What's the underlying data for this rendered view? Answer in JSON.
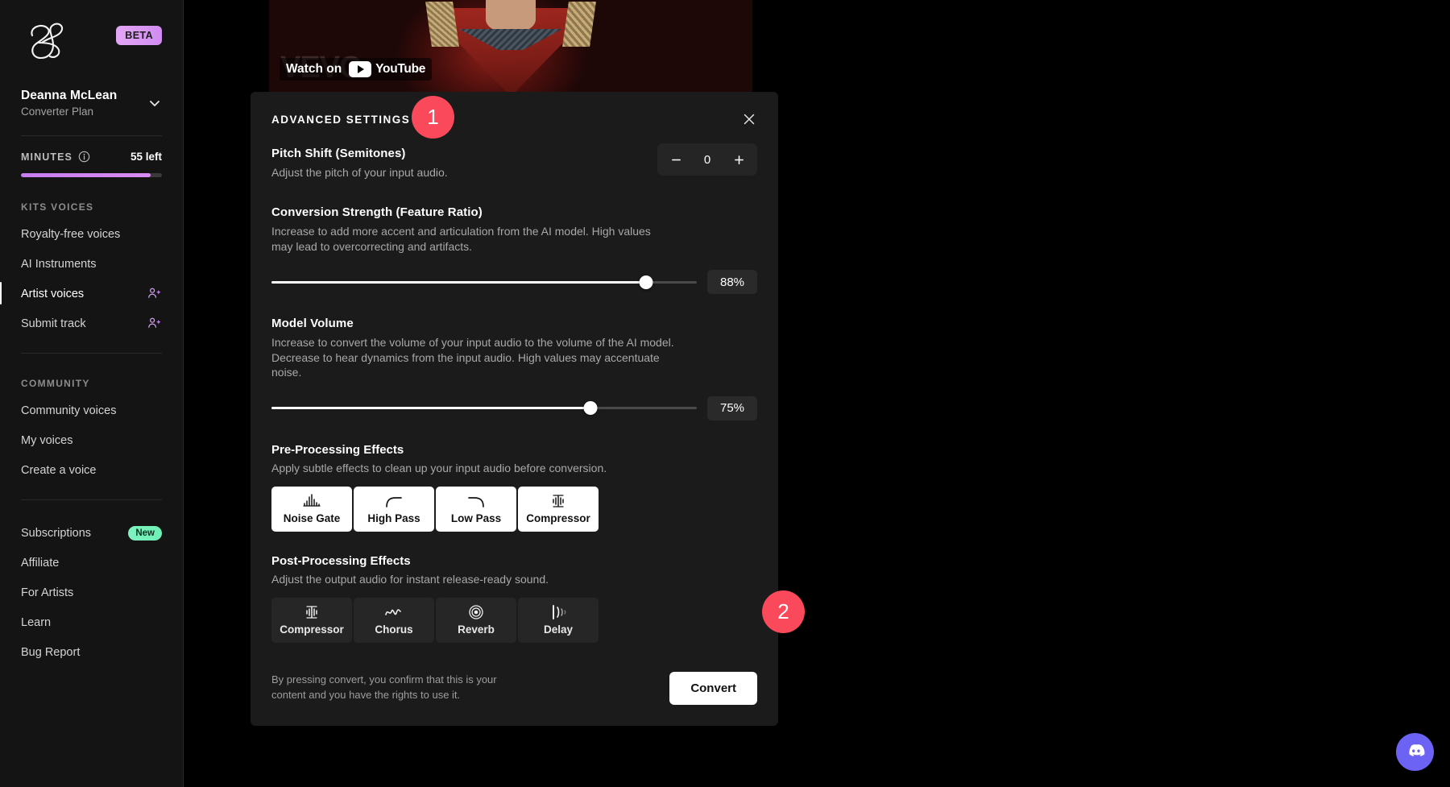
{
  "sidebar": {
    "badge": "BETA",
    "user": {
      "name": "Deanna McLean",
      "plan": "Converter Plan"
    },
    "minutes": {
      "label": "MINUTES",
      "remaining": "55 left",
      "percent": 92
    },
    "sections": [
      {
        "heading": "KITS VOICES",
        "items": [
          {
            "label": "Royalty-free voices",
            "icon": null,
            "active": false,
            "badge": null
          },
          {
            "label": "AI Instruments",
            "icon": null,
            "active": false,
            "badge": null
          },
          {
            "label": "Artist voices",
            "icon": "user-sparkle-icon",
            "active": true,
            "badge": null
          },
          {
            "label": "Submit track",
            "icon": "user-sparkle-icon",
            "active": false,
            "badge": null
          }
        ]
      },
      {
        "heading": "COMMUNITY",
        "items": [
          {
            "label": "Community voices",
            "icon": null,
            "active": false,
            "badge": null
          },
          {
            "label": "My voices",
            "icon": null,
            "active": false,
            "badge": null
          },
          {
            "label": "Create a voice",
            "icon": null,
            "active": false,
            "badge": null
          }
        ]
      },
      {
        "heading": null,
        "items": [
          {
            "label": "Subscriptions",
            "icon": null,
            "active": false,
            "badge": "New"
          },
          {
            "label": "Affiliate",
            "icon": null,
            "active": false,
            "badge": null
          },
          {
            "label": "For Artists",
            "icon": null,
            "active": false,
            "badge": null
          },
          {
            "label": "Learn",
            "icon": null,
            "active": false,
            "badge": null
          },
          {
            "label": "Bug Report",
            "icon": null,
            "active": false,
            "badge": null
          }
        ]
      }
    ]
  },
  "video": {
    "watch_text": "Watch on",
    "platform": "YouTube",
    "watermark": "VEVO"
  },
  "panel": {
    "title": "ADVANCED SETTINGS",
    "pitch": {
      "title": "Pitch Shift (Semitones)",
      "description": "Adjust the pitch of your input audio.",
      "value": "0",
      "minus": "−",
      "plus": "+"
    },
    "conversion_strength": {
      "title": "Conversion Strength (Feature Ratio)",
      "description": "Increase to add more accent and articulation from the AI model. High values may lead to overcorrecting and artifacts.",
      "value": "88%",
      "percent": 88
    },
    "model_volume": {
      "title": "Model Volume",
      "description": "Increase to convert the volume of your input audio to the volume of the AI model. Decrease to hear dynamics from the input audio. High values may accentuate noise.",
      "value": "75%",
      "percent": 75
    },
    "pre_processing": {
      "title": "Pre-Processing Effects",
      "description": "Apply subtle effects to clean up your input audio before conversion.",
      "effects": [
        {
          "label": "Noise Gate",
          "icon": "noise-gate-icon",
          "active": true
        },
        {
          "label": "High Pass",
          "icon": "high-pass-icon",
          "active": true
        },
        {
          "label": "Low Pass",
          "icon": "low-pass-icon",
          "active": true
        },
        {
          "label": "Compressor",
          "icon": "compressor-icon",
          "active": true
        }
      ]
    },
    "post_processing": {
      "title": "Post-Processing Effects",
      "description": "Adjust the output audio for instant release-ready sound.",
      "effects": [
        {
          "label": "Compressor",
          "icon": "compressor-icon",
          "active": false
        },
        {
          "label": "Chorus",
          "icon": "chorus-icon",
          "active": false
        },
        {
          "label": "Reverb",
          "icon": "reverb-icon",
          "active": false
        },
        {
          "label": "Delay",
          "icon": "delay-icon",
          "active": false
        }
      ]
    },
    "footer": {
      "disclaimer": "By pressing convert, you confirm that this is your content and you have the rights to use it.",
      "convert_label": "Convert"
    }
  },
  "markers": [
    {
      "number": "1"
    },
    {
      "number": "2"
    }
  ],
  "chat": {
    "icon": "discord-icon"
  },
  "colors": {
    "accent_marker": "#f9495a",
    "beta_badge": "#d9a0f2",
    "new_badge": "#7ef2c0",
    "discord": "#6c63f5",
    "panel_bg": "#1b1b1b"
  }
}
